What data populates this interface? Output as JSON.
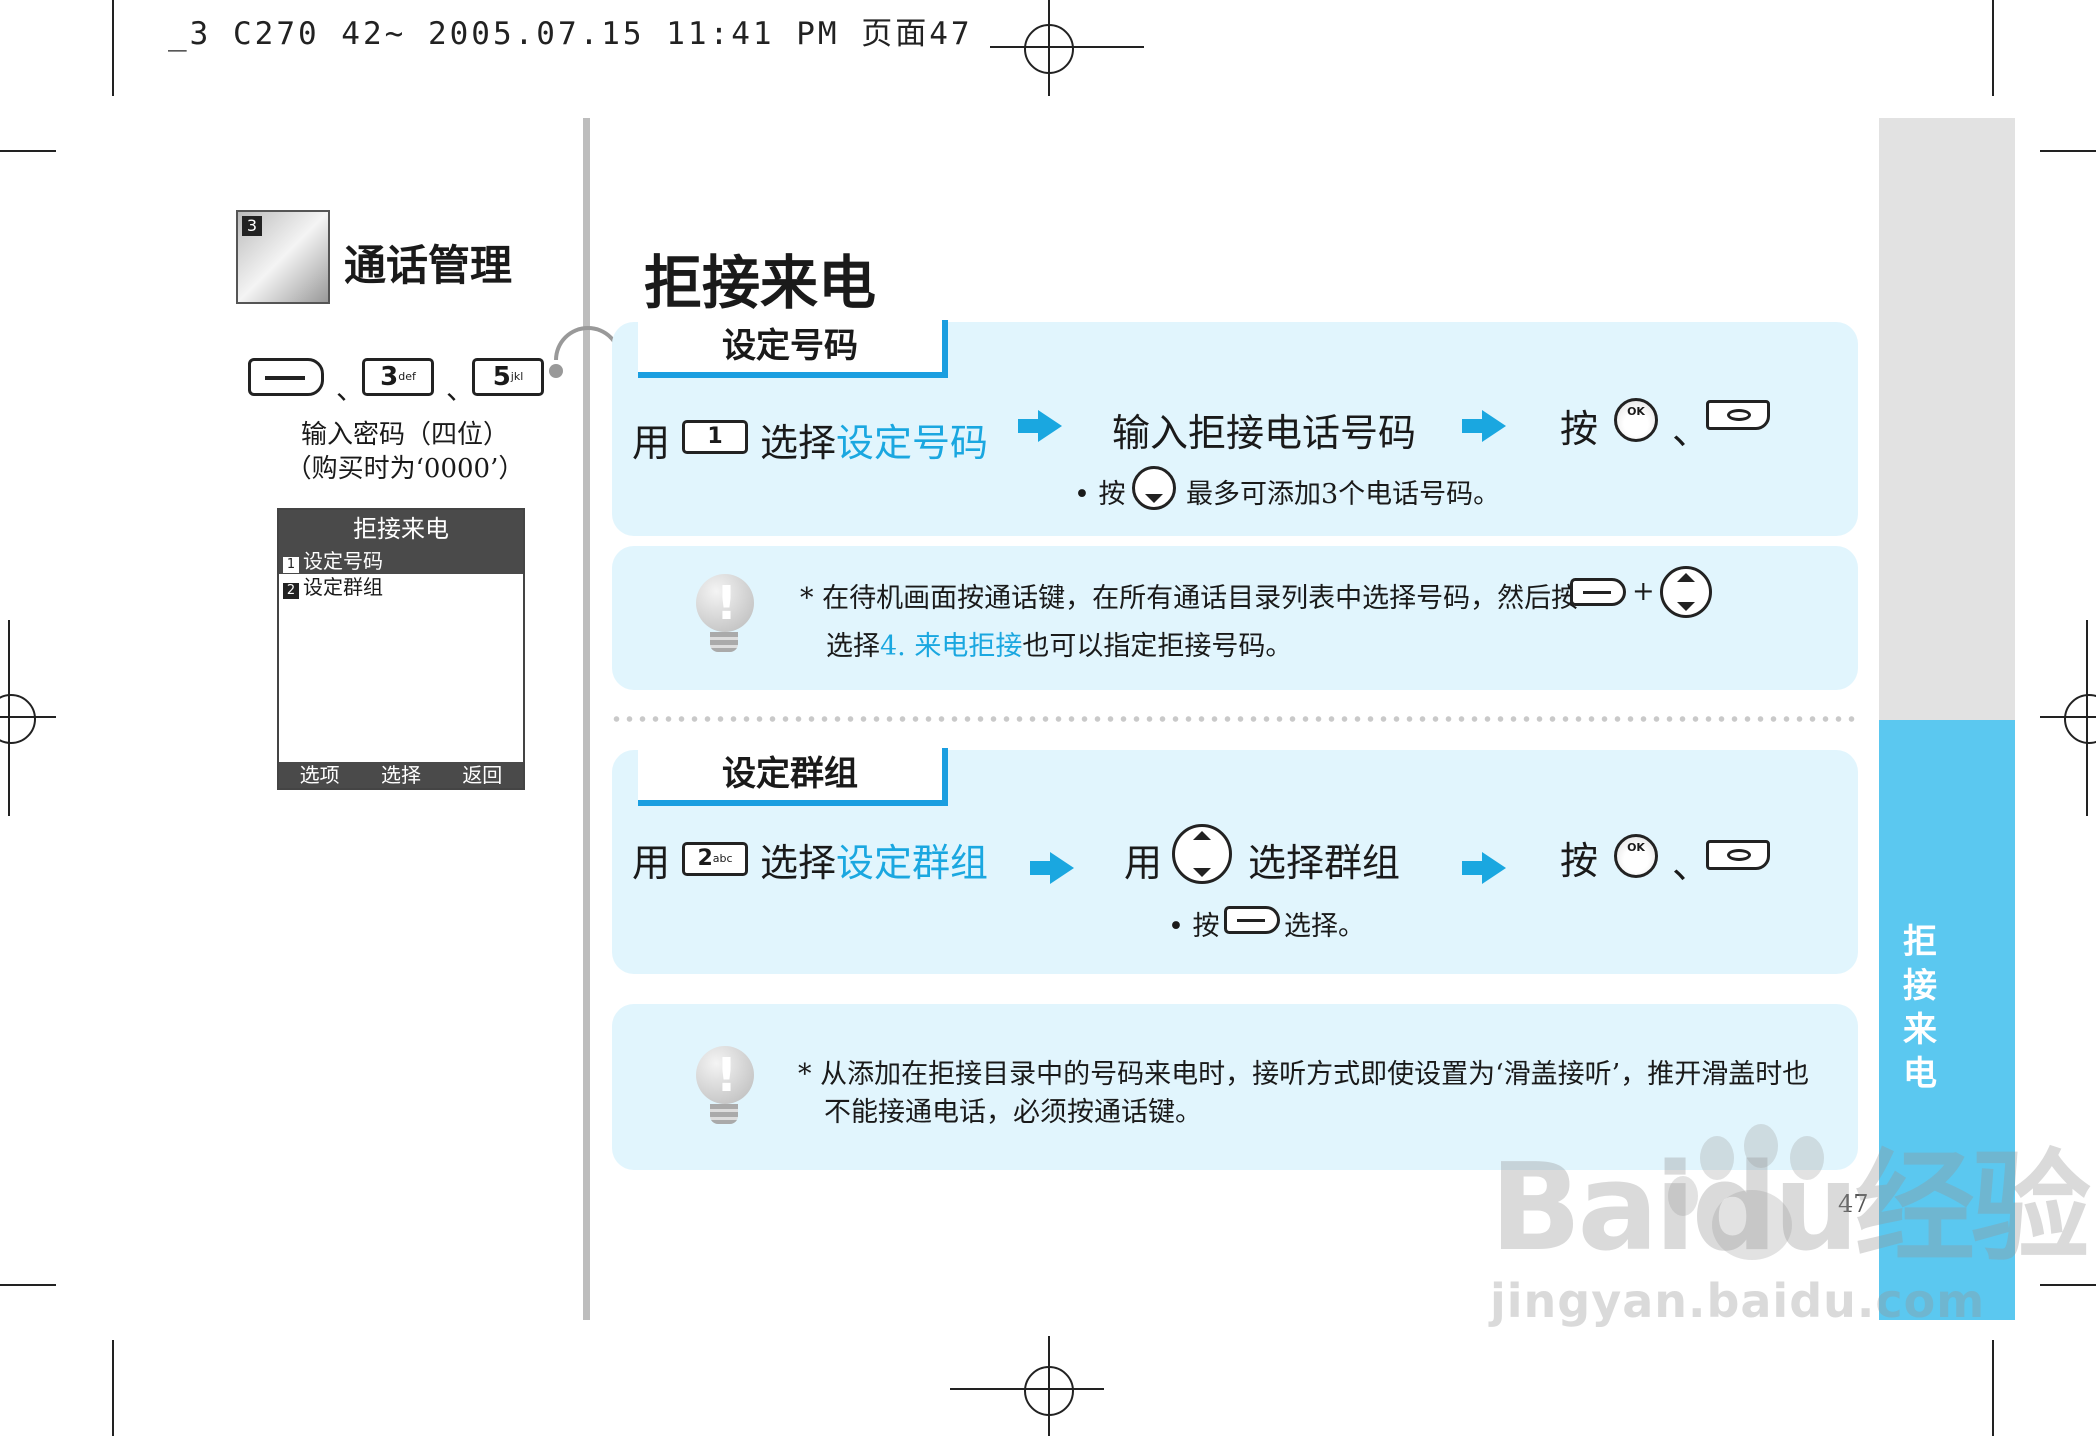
{
  "header": "_3 C270 42~ 2005.07.15 11:41 PM 页面47",
  "section": {
    "number": "3",
    "title": "通话管理"
  },
  "shortcut": {
    "key1_num": "3",
    "key1_sub": "def",
    "key2_num": "5",
    "key2_sub": "jkl",
    "sep": "、",
    "password_line1": "输入密码（四位）",
    "password_line2": "（购买时为‘0000’）"
  },
  "phone_screen": {
    "title": "拒接来电",
    "items": [
      {
        "num": "1",
        "label": "设定号码"
      },
      {
        "num": "2",
        "label": "设定群组"
      }
    ],
    "softkeys": [
      "选项",
      "选择",
      "返回"
    ]
  },
  "main_title": "拒接来电",
  "side_title": "拒接来电",
  "page_number": "47",
  "set_number": {
    "tab": "设定号码",
    "step1_prefix": "用",
    "step1_key": "1",
    "step1_text": "选择",
    "step1_hl": "设定号码",
    "step2_text": "输入拒接电话号码",
    "step3_text": "按",
    "step3_sep": "、",
    "note_prefix": "• 按",
    "note_text": "最多可添加3个电话号码。"
  },
  "tip1": {
    "line1_text": "* 在待机画面按通话键，在所有通话目录列表中选择号码，然后按",
    "plus": "+",
    "line2_prefix": "选择",
    "line2_hl": "4. 来电拒接",
    "line2_suffix": "也可以指定拒接号码。"
  },
  "set_group": {
    "tab": "设定群组",
    "step1_prefix": "用",
    "step1_key": "2",
    "step1_key_sub": "abc",
    "step1_text": "选择",
    "step1_hl": "设定群组",
    "step2_prefix": "用",
    "step2_text": "选择群组",
    "step3_text": "按",
    "step3_sep": "、",
    "note_prefix": "• 按",
    "note_text": "选择。"
  },
  "tip2": {
    "line1": "* 从添加在拒接目录中的号码来电时，接听方式即使设置为‘滑盖接听’，推开滑盖时也",
    "line2": "不能接通电话，必须按通话键。"
  },
  "watermark": {
    "brand": "Bai",
    "brand2": "du",
    "cn": "经验",
    "url": "jingyan.baidu.com"
  }
}
